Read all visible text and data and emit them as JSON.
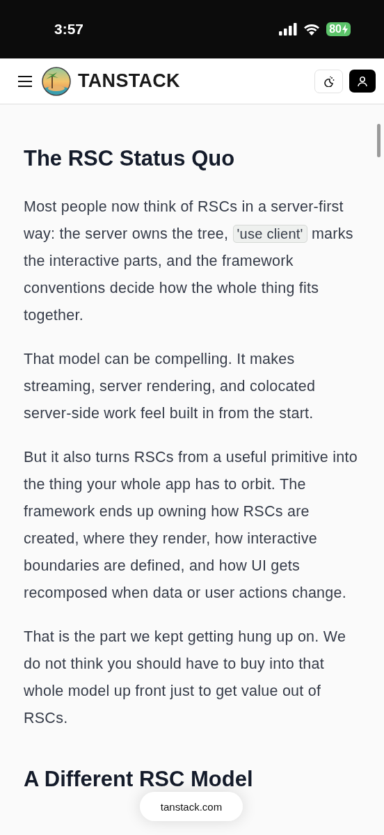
{
  "status_bar": {
    "time": "3:57",
    "battery": "80"
  },
  "header": {
    "logo_text": "TANSTACK"
  },
  "article": {
    "sections": [
      {
        "heading": "The RSC Status Quo",
        "paragraphs": [
          [
            {
              "kind": "text",
              "text": "Most people now think of RSCs in a server-first way: the server owns the tree, "
            },
            {
              "kind": "code",
              "text": "'use client'"
            },
            {
              "kind": "text",
              "text": " marks the interactive parts, and the framework conventions decide how the whole thing fits together."
            }
          ],
          [
            {
              "kind": "text",
              "text": "That model can be compelling. It makes streaming, server rendering, and colocated server-side work feel built in from the start."
            }
          ],
          [
            {
              "kind": "text",
              "text": "But it also turns RSCs from a useful primitive into the thing your whole app has to orbit. The framework ends up owning how RSCs are created, where they render, how interactive boundaries are defined, and how UI gets recomposed when data or user actions change."
            }
          ],
          [
            {
              "kind": "text",
              "text": "That is the part we kept getting hung up on. We do not think you should have to buy into that whole model up front just to get value out of RSCs."
            }
          ]
        ]
      },
      {
        "heading": "A Different RSC Model"
      }
    ]
  },
  "url_pill": "tanstack.com"
}
